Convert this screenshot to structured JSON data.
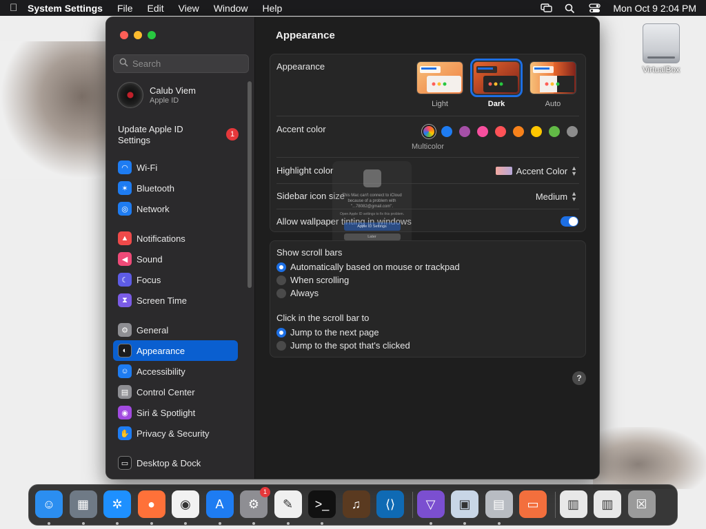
{
  "menubar": {
    "app_name": "System Settings",
    "menus": [
      "File",
      "Edit",
      "View",
      "Window",
      "Help"
    ],
    "clock": "Mon Oct 9  2:04 PM"
  },
  "sidebar": {
    "search_placeholder": "Search",
    "profile": {
      "name": "Calub Viem",
      "subtitle": "Apple ID"
    },
    "update": {
      "label": "Update Apple ID Settings",
      "badge": "1"
    },
    "items": [
      {
        "label": "Wi-Fi",
        "icon": "wifi-icon",
        "color": "#1e7cf2"
      },
      {
        "label": "Bluetooth",
        "icon": "bluetooth-icon",
        "color": "#1e7cf2"
      },
      {
        "label": "Network",
        "icon": "globe-icon",
        "color": "#1e7cf2"
      },
      {
        "label": "Notifications",
        "icon": "bell-icon",
        "color": "#ef4a4a"
      },
      {
        "label": "Sound",
        "icon": "speaker-icon",
        "color": "#ef4a78"
      },
      {
        "label": "Focus",
        "icon": "moon-icon",
        "color": "#5e5ce6"
      },
      {
        "label": "Screen Time",
        "icon": "hourglass-icon",
        "color": "#7b5ce6"
      },
      {
        "label": "General",
        "icon": "gear-icon",
        "color": "#8e8e93"
      },
      {
        "label": "Appearance",
        "icon": "appearance-icon",
        "color": "#1c1c1e"
      },
      {
        "label": "Accessibility",
        "icon": "accessibility-icon",
        "color": "#1e7cf2"
      },
      {
        "label": "Control Center",
        "icon": "control-center-icon",
        "color": "#8e8e93"
      },
      {
        "label": "Siri & Spotlight",
        "icon": "siri-icon",
        "color": "#a24be0"
      },
      {
        "label": "Privacy & Security",
        "icon": "hand-icon",
        "color": "#1e7cf2"
      },
      {
        "label": "Desktop & Dock",
        "icon": "dock-icon",
        "color": "#1c1c1e"
      }
    ]
  },
  "content": {
    "title": "Appearance",
    "appearance": {
      "label": "Appearance",
      "options": [
        {
          "label": "Light",
          "selected": false
        },
        {
          "label": "Dark",
          "selected": true
        },
        {
          "label": "Auto",
          "selected": false
        }
      ]
    },
    "accent": {
      "label": "Accent color",
      "selected_label": "Multicolor",
      "colors": [
        "#1e7cf2",
        "#a550a7",
        "#f74f9e",
        "#ff5257",
        "#f7821b",
        "#ffc600",
        "#62ba46",
        "#8c8c8c"
      ]
    },
    "highlight": {
      "label": "Highlight color",
      "value": "Accent Color"
    },
    "sidebar_icon_size": {
      "label": "Sidebar icon size",
      "value": "Medium"
    },
    "wallpaper_tinting": {
      "label": "Allow wallpaper tinting in windows",
      "on": true
    },
    "scroll_bars": {
      "label": "Show scroll bars",
      "options": [
        {
          "label": "Automatically based on mouse or trackpad",
          "selected": true
        },
        {
          "label": "When scrolling",
          "selected": false
        },
        {
          "label": "Always",
          "selected": false
        }
      ]
    },
    "click_scroll": {
      "label": "Click in the scroll bar to",
      "options": [
        {
          "label": "Jump to the next page",
          "selected": true
        },
        {
          "label": "Jump to the spot that's clicked",
          "selected": false
        }
      ]
    },
    "help": "?"
  },
  "ghost_dialog": {
    "text": "This Mac can't connect to iCloud because of a problem with \"...78082@gmail.com\".",
    "subtext": "Open Apple ID settings to fix this problem.",
    "primary_button": "Apple ID Settings",
    "secondary_button": "Later"
  },
  "desktop": {
    "disk_label": "VirtualBox"
  },
  "dock": {
    "items": [
      {
        "name": "finder",
        "color": "#2b8ef0"
      },
      {
        "name": "launchpad",
        "color": "#6f7a86"
      },
      {
        "name": "safari",
        "color": "#1e90ff"
      },
      {
        "name": "firefox",
        "color": "#ff7139"
      },
      {
        "name": "chrome",
        "color": "#f2f2f2"
      },
      {
        "name": "app-store",
        "color": "#1e7cf2"
      },
      {
        "name": "system-settings",
        "color": "#8e8e93",
        "badge": "1"
      },
      {
        "name": "textedit",
        "color": "#f0f0f0"
      },
      {
        "name": "terminal",
        "color": "#111111"
      },
      {
        "name": "garageband",
        "color": "#5a3a20"
      },
      {
        "name": "vscode",
        "color": "#0f6ab4"
      },
      {
        "name": "ai-app",
        "color": "#7b4fd0"
      },
      {
        "name": "preview",
        "color": "#c8d6e6"
      },
      {
        "name": "installer",
        "color": "#b8bcc2"
      },
      {
        "name": "virtualbox-app",
        "color": "#f36f3d"
      },
      {
        "name": "downloads-stack",
        "color": "#e8e8e8"
      },
      {
        "name": "documents-stack",
        "color": "#e8e8e8"
      },
      {
        "name": "trash",
        "color": "#9a9a9a"
      }
    ]
  }
}
